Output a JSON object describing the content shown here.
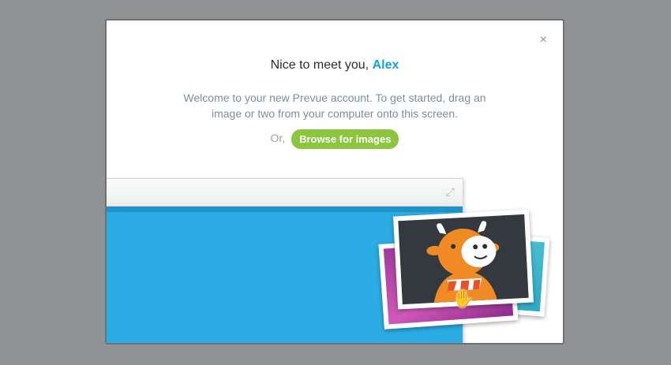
{
  "modal": {
    "close_label": "×",
    "greeting": "Nice to meet you,",
    "user_name": "Alex",
    "description": "Welcome to your new Prevue account. To get started, drag an image or two from your computer onto this screen.",
    "or_label": "Or,",
    "browse_label": "Browse for images"
  },
  "illustration": {
    "expand_icon": "expand-icon",
    "cursor_icon": "grab-hand-icon",
    "mascot": "cow-mascot"
  },
  "colors": {
    "accent": "#16a3d6",
    "button": "#8cc63f",
    "canvas": "#2bace4"
  }
}
